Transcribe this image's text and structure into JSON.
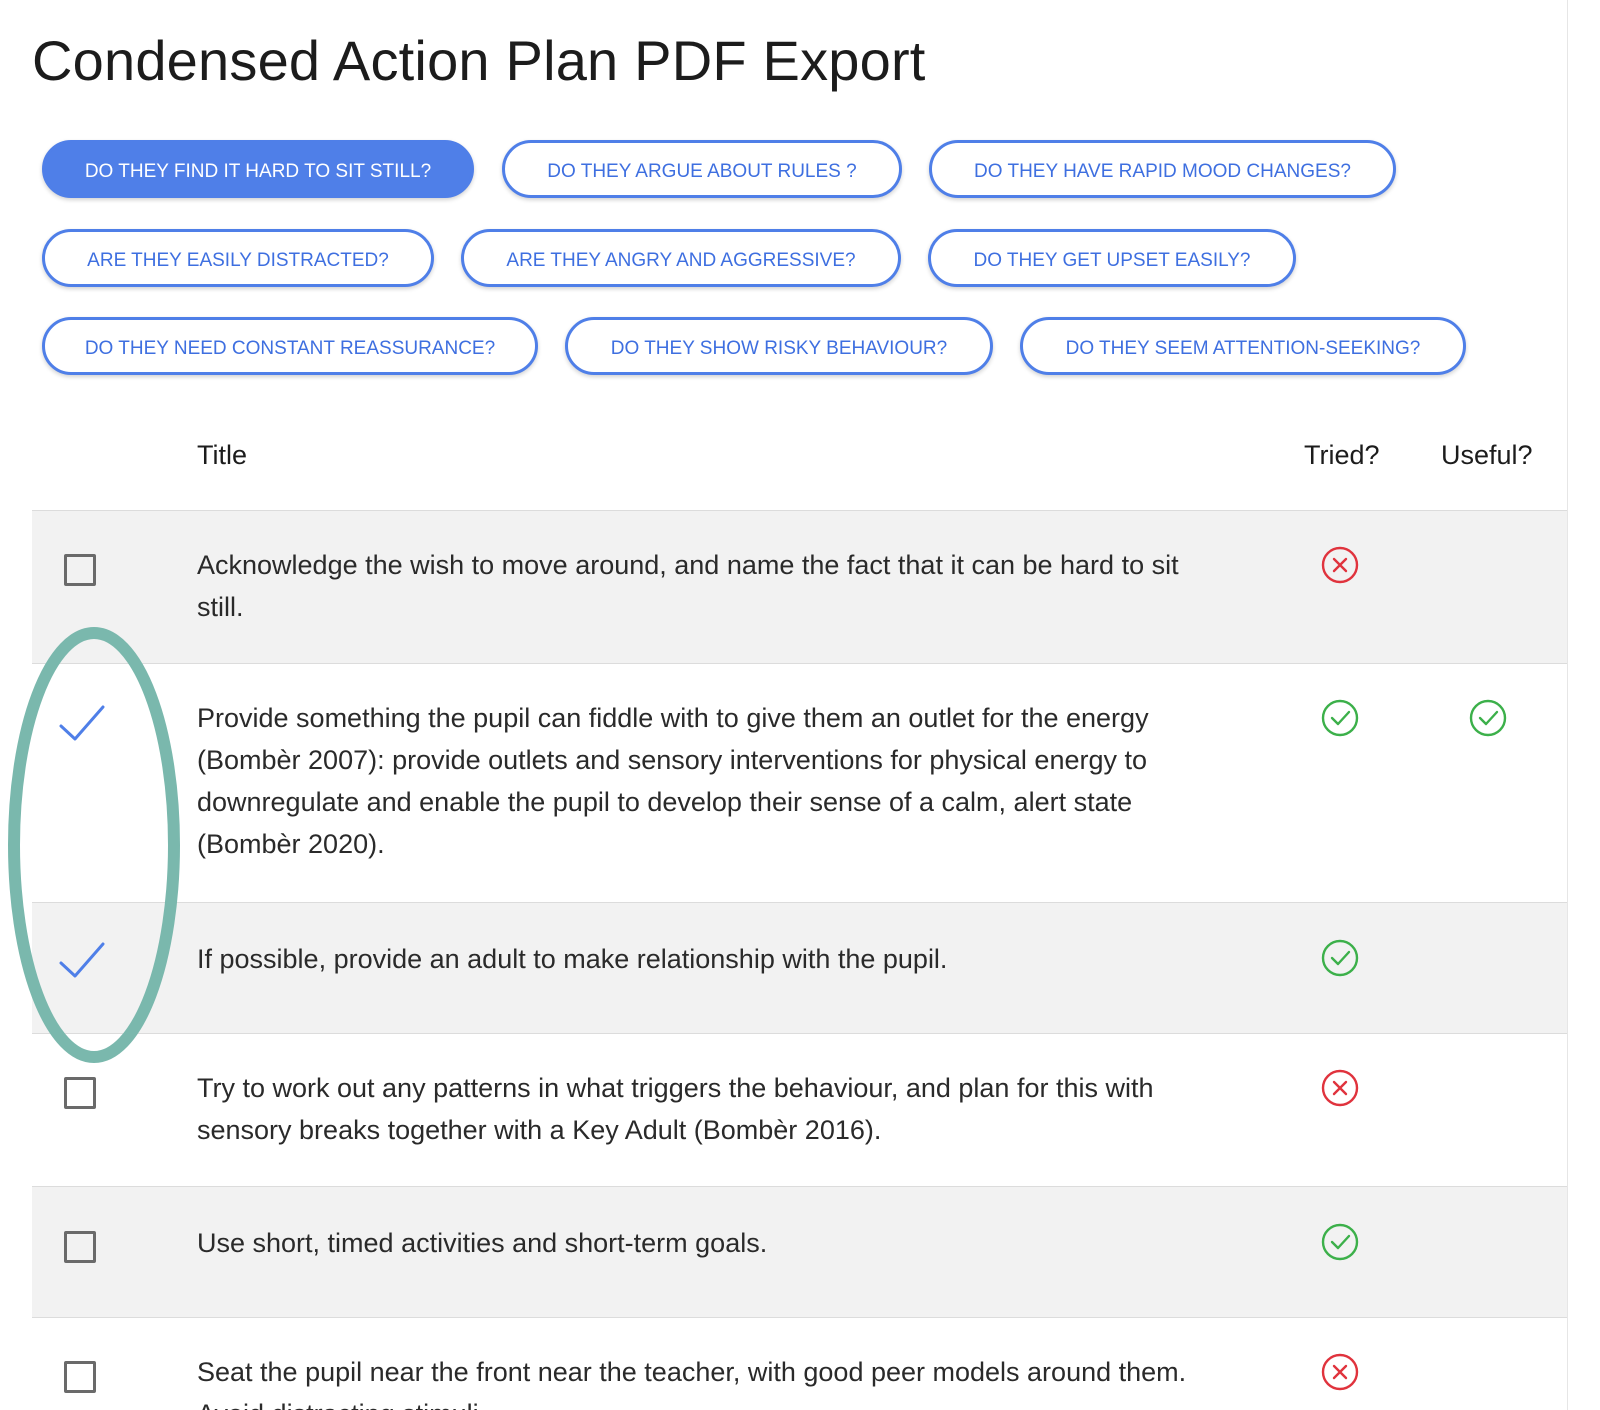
{
  "page": {
    "title": "Condensed Action Plan PDF Export"
  },
  "filters": [
    {
      "label": "DO THEY FIND IT HARD TO SIT STILL?",
      "active": true
    },
    {
      "label": "DO THEY ARGUE ABOUT RULES ?",
      "active": false
    },
    {
      "label": "DO THEY HAVE RAPID MOOD CHANGES?",
      "active": false
    },
    {
      "label": "ARE THEY EASILY DISTRACTED?",
      "active": false
    },
    {
      "label": "ARE THEY ANGRY AND AGGRESSIVE?",
      "active": false
    },
    {
      "label": "DO THEY GET UPSET EASILY?",
      "active": false
    },
    {
      "label": "DO THEY NEED CONSTANT REASSURANCE?",
      "active": false
    },
    {
      "label": "DO THEY SHOW RISKY BEHAVIOUR?",
      "active": false
    },
    {
      "label": "DO THEY SEEM ATTENTION-SEEKING?",
      "active": false
    }
  ],
  "table": {
    "headers": {
      "title": "Title",
      "tried": "Tried?",
      "useful": "Useful?"
    },
    "rows": [
      {
        "selected": false,
        "title": "Acknowledge the wish to move around, and name the fact that it can be hard to sit still.",
        "tried": "no",
        "useful": ""
      },
      {
        "selected": true,
        "title": "Provide something the pupil can fiddle with to give them an outlet for the energy (Bombèr 2007): provide outlets and sensory interventions for physical energy to downregulate and enable the pupil to develop their sense of a calm, alert state (Bombèr 2020).",
        "tried": "yes",
        "useful": "yes"
      },
      {
        "selected": true,
        "title": "If possible, provide an adult to make relationship with the pupil.",
        "tried": "yes",
        "useful": ""
      },
      {
        "selected": false,
        "title": "Try to work out any patterns in what triggers the behaviour, and plan for this with sensory breaks together with a Key Adult (Bombèr 2016).",
        "tried": "no",
        "useful": ""
      },
      {
        "selected": false,
        "title": "Use short, timed activities and short-term goals.",
        "tried": "yes",
        "useful": ""
      },
      {
        "selected": false,
        "title": "Seat the pupil near the front near the teacher, with good peer models around them. Avoid distracting stimuli.",
        "tried": "no",
        "useful": ""
      }
    ]
  },
  "icons": {
    "yes": "check-circle-icon",
    "no": "x-circle-icon",
    "selected": "checkmark-icon",
    "unselected": "checkbox-icon"
  },
  "colors": {
    "accent": "#4f7fe8",
    "yes": "#3cb04a",
    "no": "#e0333d",
    "annotation": "#7ab8ad",
    "row_alt": "#f2f2f2"
  }
}
